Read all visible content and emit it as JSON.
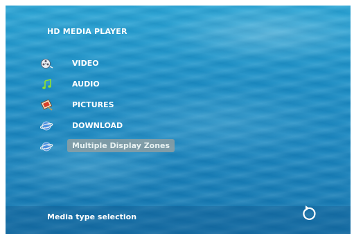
{
  "header": {
    "title": "HD MEDIA PLAYER"
  },
  "menu": {
    "items": [
      {
        "label": "VIDEO",
        "icon": "film-reel-icon"
      },
      {
        "label": "AUDIO",
        "icon": "music-note-icon"
      },
      {
        "label": "PICTURES",
        "icon": "picture-icon"
      },
      {
        "label": "DOWNLOAD",
        "icon": "globe-icon"
      },
      {
        "label": "Multiple Display Zones",
        "icon": "globe-icon",
        "selected": true
      }
    ]
  },
  "status": {
    "text": "Media type selection",
    "back_icon": "return-arrow-icon"
  },
  "colors": {
    "water": "#1c8fc6",
    "highlight": "#969fa0",
    "text": "#ffffff",
    "note": "#8fe030"
  }
}
